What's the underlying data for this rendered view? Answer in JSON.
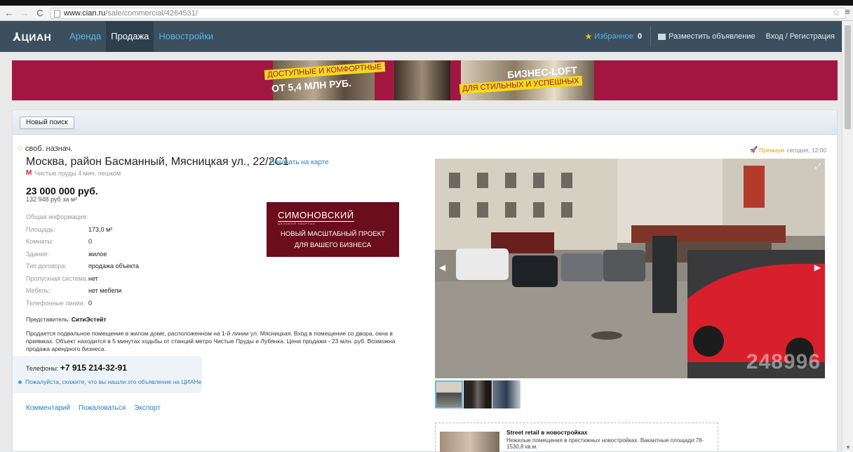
{
  "browser": {
    "url_host": "www.cian.ru",
    "url_path": "/sale/commercial/4264531/"
  },
  "header": {
    "logo": "ЦИАН",
    "nav": [
      {
        "label": "Аренда"
      },
      {
        "label": "Продажа"
      },
      {
        "label": "Новостройки"
      }
    ],
    "favorites_label": "Избранное",
    "favorites_count": "0",
    "post_ad": "Разместить объявление",
    "login": "Вход / Регистрация"
  },
  "banner": {
    "tag1": "ДОСТУПНЫЕ И КОМФОРТНЫЕ",
    "tag2": "ОТ 5,4 МЛН РУБ.",
    "tag3": "БИЗНЕС-LOFT",
    "tag4": "ДЛЯ СТИЛЬНЫХ И УСПЕШНЫХ"
  },
  "toolbar": {
    "new_search": "Новый поиск"
  },
  "listing": {
    "category": "своб. назнач.",
    "address": "Москва, район Басманный, Мясницкая ул., 22/2С1",
    "map_link": "Показать на карте",
    "metro": "Чистые пруды 4 мин. пешком",
    "metro_mark": "М",
    "price": "23 000 000 руб.",
    "price_m2": "132 948 руб за м²",
    "premium_label": "Премиум",
    "posted": "сегодня, 12:00",
    "info_title": "Общая информация:",
    "info": [
      {
        "k": "Площадь:",
        "v": "173,0 м²"
      },
      {
        "k": "Комнаты:",
        "v": "0"
      },
      {
        "k": "Здание:",
        "v": "жилое"
      },
      {
        "k": "Тип договора:",
        "v": "продажа объекта"
      },
      {
        "k": "Пропускная система:",
        "v": "нет"
      },
      {
        "k": "Мебель:",
        "v": "нет мебели"
      },
      {
        "k": "Телефонные линии:",
        "v": "0"
      }
    ],
    "rep_label": "Представитель:",
    "rep_name": "СитиЭстейт",
    "description": "Продается подвальное помещение в жилом доме, расположенном на 1-й линии ул. Мясницкая. Вход в помещение со двора, окна в приямках. Объект находится в 5 минутах ходьбы от станций метро Чистые Пруды и Лубянка. Цена продажи - 23 млн. руб. Возможна продажа арендного бизнеса.",
    "phone_label": "Телефоны:",
    "phone": "+7 915 214-32-91",
    "phone_hint": "Пожалуйста, скажите, что вы нашли это объявление на ЦИАНе",
    "actions": [
      {
        "label": "Комментарий"
      },
      {
        "label": "Пожаловаться"
      },
      {
        "label": "Экспорт"
      }
    ],
    "watermark": "248996"
  },
  "promo": {
    "brand": "СИМОНОВСКИЙ",
    "sub": "ДЕЛОВОЙ КВАРТАЛ",
    "line1": "НОВЫЙ МАСШТАБНЫЙ ПРОЕКТ",
    "line2": "ДЛЯ ВАШЕГО БИЗНЕСА"
  },
  "adv": {
    "title": "Street retail в новостройках",
    "text": "Нежилые помещения в престижных новостройках. Вакантные площади:78-1530,8 кв.м."
  }
}
